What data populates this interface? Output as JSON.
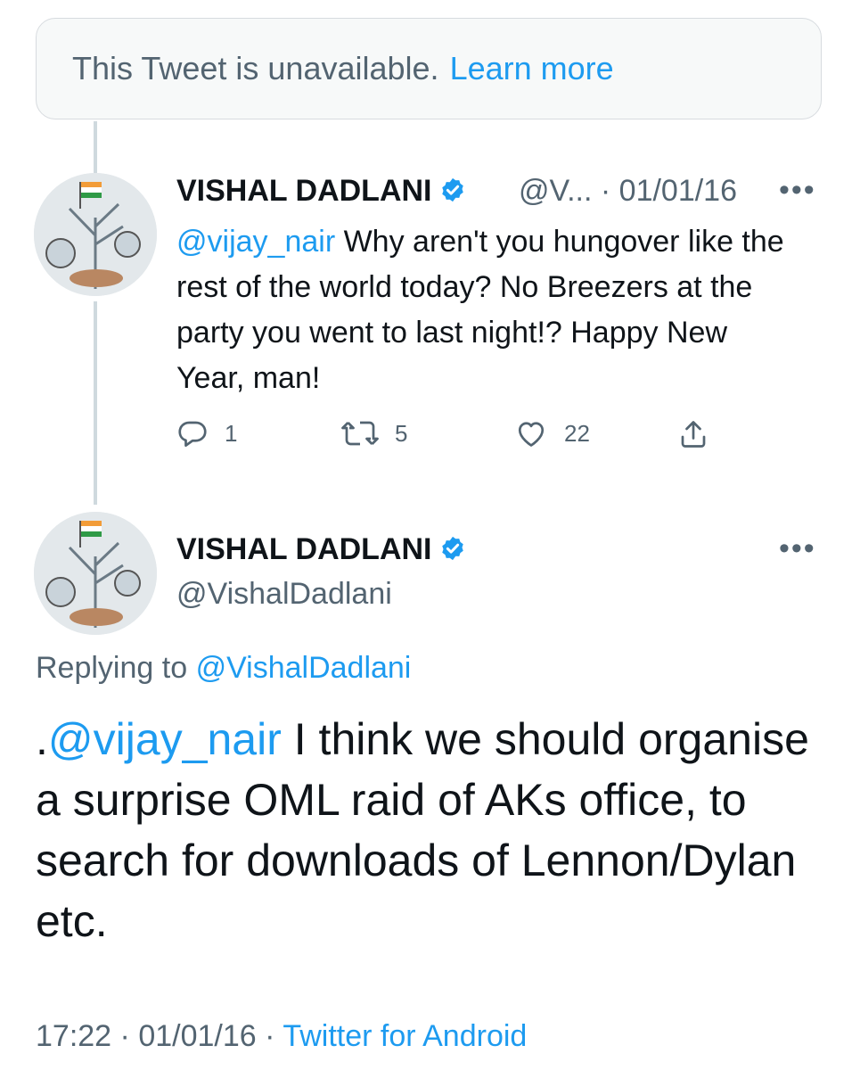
{
  "unavailable": {
    "text": "This Tweet is unavailable.",
    "link": "Learn more"
  },
  "tweet1": {
    "name": "VISHAL DADLANI",
    "handle_truncated": "@V...",
    "separator": "·",
    "date": "01/01/16",
    "mention": "@vijay_nair",
    "text": " Why aren't you hungover like the rest of the world today? No Breezers at the party you went to last night!? Happy New Year, man!",
    "replies": "1",
    "retweets": "5",
    "likes": "22",
    "more": "•••"
  },
  "tweet2": {
    "name": "VISHAL DADLANI",
    "handle": "@VishalDadlani",
    "more": "•••",
    "replying_prefix": "Replying to",
    "replying_handle": "@VishalDadlani",
    "text_prefix": ".",
    "mention": "@vijay_nair",
    "text": " I think we should organise a surprise OML raid of AKs office, to search for downloads of Lennon/Dylan etc.",
    "time": "17:22",
    "date": "01/01/16",
    "source": "Twitter for Android",
    "separator": "·"
  },
  "colors": {
    "accent": "#1d9bf0",
    "muted": "#536471",
    "text": "#0f1419",
    "line": "#cfd9de"
  },
  "icons": [
    "verified-badge-icon",
    "reply-icon",
    "retweet-icon",
    "like-icon",
    "share-icon",
    "more-icon",
    "avatar-image"
  ]
}
